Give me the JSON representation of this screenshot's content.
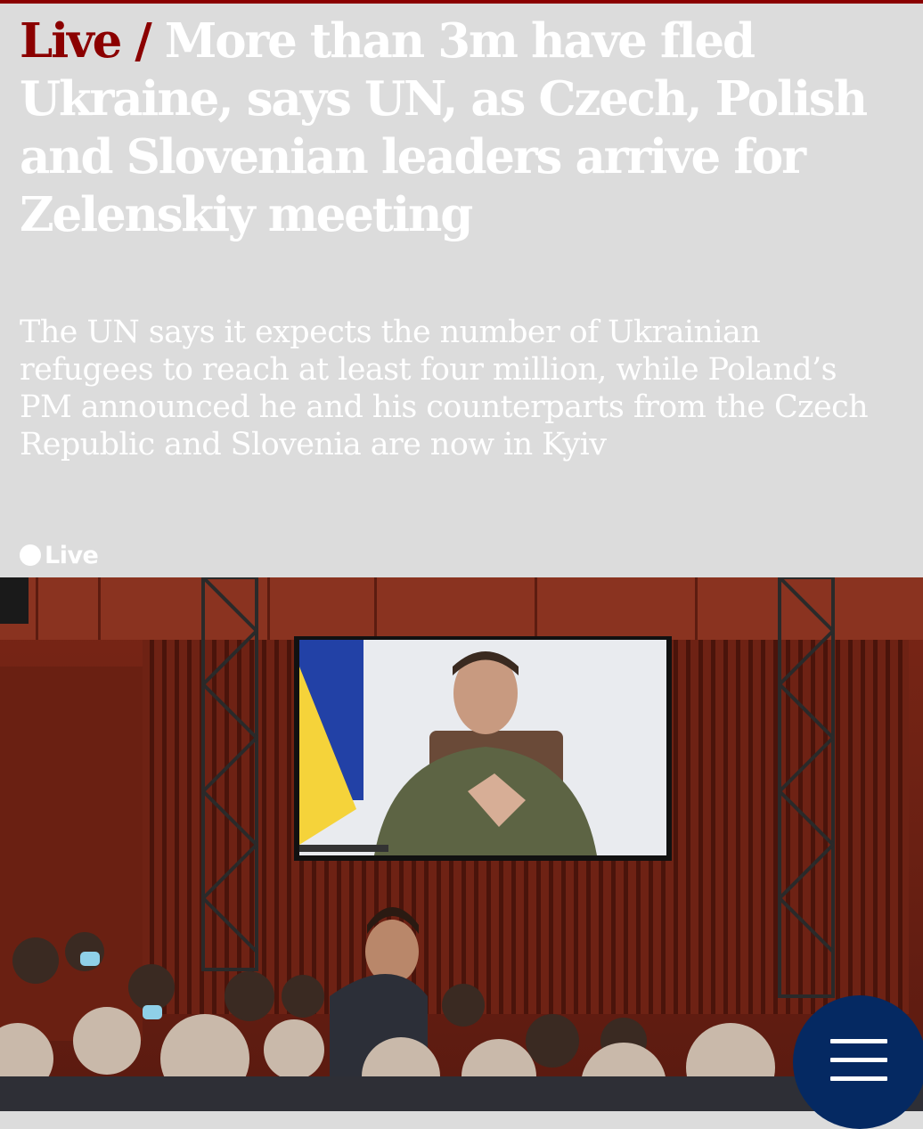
{
  "article": {
    "kicker": "Live /",
    "headline": "More than 3m have fled Ukraine, says UN, as Czech, Polish and Slovenian leaders arrive for Zelenskiy meeting",
    "standfirst": "The UN says it expects the number of Ukrainian refugees to reach at least four million, while Poland’s PM announced he and his counterparts from the Czech Republic and Slovenia are now in Kyiv",
    "live_label": "Live"
  },
  "colors": {
    "kicker": "#8b0000",
    "header_background": "#dcdcdc",
    "menu_button": "#052962"
  },
  "icons": {
    "live_indicator": "live-dot-icon",
    "menu": "hamburger-menu-icon"
  }
}
